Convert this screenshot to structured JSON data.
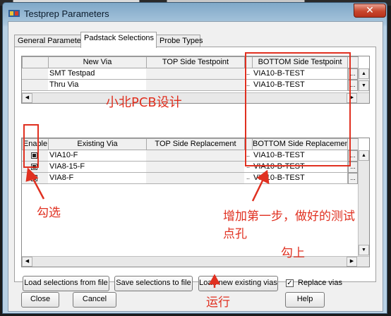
{
  "window": {
    "title": "Testprep Parameters",
    "close_glyph": "✕"
  },
  "tabs": [
    {
      "label": "General Parameters",
      "active": false
    },
    {
      "label": "Padstack Selections",
      "active": true
    },
    {
      "label": "Probe Types",
      "active": false
    }
  ],
  "top_grid": {
    "headers": [
      "New Via",
      "TOP Side Testpoint",
      "BOTTOM Side Testpoint"
    ],
    "rows": [
      {
        "new_via": "SMT Testpad",
        "top": "",
        "bottom": "VIA10-B-TEST"
      },
      {
        "new_via": "Thru Via",
        "top": "",
        "bottom": "VIA10-B-TEST"
      }
    ]
  },
  "bottom_grid": {
    "headers": [
      "Enable",
      "Existing Via",
      "TOP Side Replacement",
      "BOTTOM Side Replacement"
    ],
    "rows": [
      {
        "enabled": true,
        "via": "VIA10-F",
        "top": "",
        "bottom": "VIA10-B-TEST"
      },
      {
        "enabled": true,
        "via": "VIA8-15-F",
        "top": "",
        "bottom": "VIA10-B-TEST"
      },
      {
        "enabled": true,
        "via": "VIA8-F",
        "top": "",
        "bottom": "VIA10-B-TEST"
      }
    ]
  },
  "buttons": {
    "load_from_file": "Load selections from file",
    "save_to_file": "Save selections to file",
    "load_existing": "Load new existing vias",
    "close": "Close",
    "cancel": "Cancel",
    "help": "Help"
  },
  "replace_vias": {
    "label": "Replace vias",
    "checked": true
  },
  "annotations": {
    "watermark": "小北PCB设计",
    "check_label": "勾选",
    "step_line1": "增加第一步，做好的测试",
    "step_line2": "点孔",
    "tick_label": "勾上",
    "run_label": "运行"
  },
  "colors": {
    "annotation_red": "#e03020",
    "titlebar": "#a8c5dc",
    "close_button": "#c8462c"
  }
}
